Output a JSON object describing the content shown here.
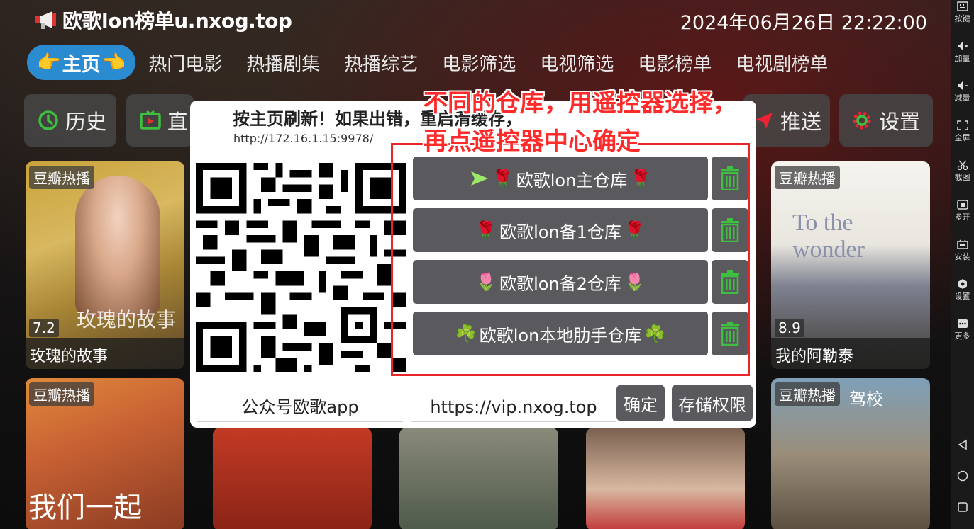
{
  "header": {
    "app_title": "欧歌lon榜单u.nxog.top",
    "datetime": "2024年06月26日 22:22:00"
  },
  "nav": {
    "home": "主页",
    "tabs": [
      "热门电影",
      "热播剧集",
      "热播综艺",
      "电影筛选",
      "电视筛选",
      "电影榜单",
      "电视剧榜单"
    ]
  },
  "shortcuts": {
    "history": "历史",
    "live": "直",
    "push": "推送",
    "settings": "设置"
  },
  "posters": [
    {
      "badge": "豆瓣热播",
      "score": "7.2",
      "title": "玫瑰的故事",
      "overlay": "玫瑰的故事"
    },
    {
      "badge": "豆瓣热播",
      "score": "8.9",
      "title": "我的阿勒泰",
      "overlay": "To the wonder"
    },
    {
      "badge": "豆瓣热播",
      "overlay": "我们一起"
    },
    {
      "badge": "豆瓣热播",
      "overlay": "驾校"
    }
  ],
  "dialog": {
    "notice": "按主页刷新！如果出错，重启清缓存，",
    "server_url": "http://172.16.1.15:9978/",
    "repos": [
      {
        "label": "欧歌lon主仓库",
        "icon": "send-icon",
        "emoji_left": "🌹",
        "emoji_right": "🌹"
      },
      {
        "label": "欧歌lon备1仓库",
        "emoji_left": "🌹",
        "emoji_right": "🌹"
      },
      {
        "label": "欧歌lon备2仓库",
        "emoji_left": "🌷",
        "emoji_right": "🌷"
      },
      {
        "label": "欧歌lon本地肋手仓库",
        "emoji_left": "☘️",
        "emoji_right": "☘️"
      }
    ],
    "field_left": "公众号欧歌app",
    "field_right": "https://vip.nxog.top",
    "confirm": "确定",
    "storage": "存储权限"
  },
  "annotation": {
    "line1": "不同的仓库，用遥控器选择，",
    "line2": "再点遥控器中心确定",
    "color": "#e8262a"
  },
  "sidebar": {
    "items": [
      "按键",
      "加量",
      "减量",
      "全屏",
      "截图",
      "多开",
      "安装",
      "设置",
      "更多"
    ]
  },
  "colors": {
    "accent": "#2b8bd1",
    "button": "#5a5a5e",
    "trash": "#3fbf3f"
  }
}
